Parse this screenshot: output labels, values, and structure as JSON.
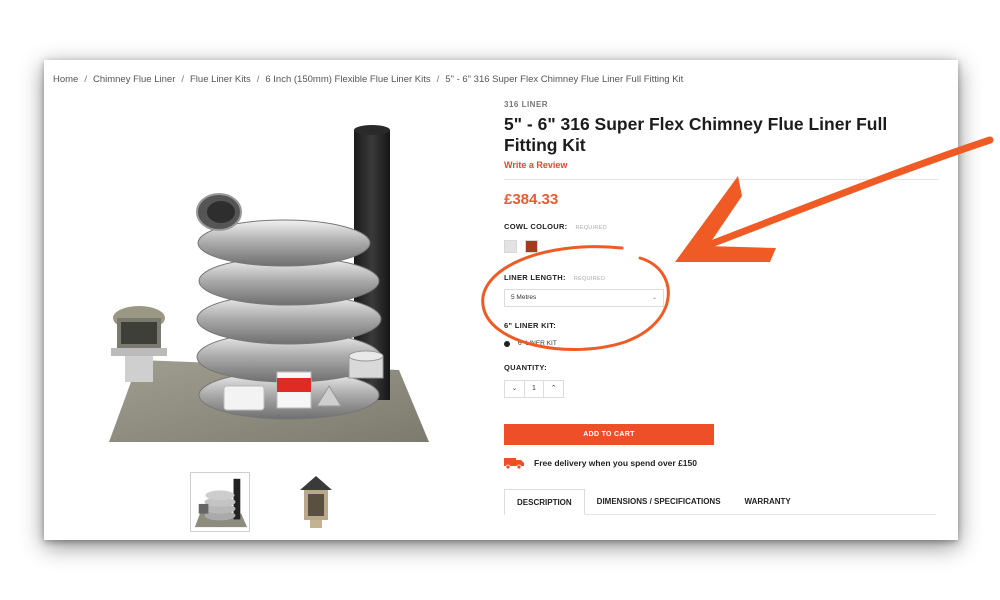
{
  "breadcrumb": [
    {
      "label": "Home"
    },
    {
      "label": "Chimney Flue Liner"
    },
    {
      "label": "Flue Liner Kits"
    },
    {
      "label": "6 Inch (150mm) Flexible Flue Liner Kits"
    },
    {
      "label": "5\" - 6\" 316 Super Flex Chimney Flue Liner Full Fitting Kit"
    }
  ],
  "product": {
    "brand": "316 LINER",
    "title": "5\" - 6\" 316 Super Flex Chimney Flue Liner Full Fitting Kit",
    "review_link": "Write a Review",
    "price": "£384.33",
    "image_alt": "316 Super Flex flue liner kit with coiled liner, black pipe, cowl, plate and accessories"
  },
  "options": {
    "cowl_colour": {
      "label": "COWL COLOUR:",
      "required": "REQUIRED",
      "swatches": [
        "#e3e3e3",
        "#a43a1f"
      ]
    },
    "liner_length": {
      "label": "LINER LENGTH:",
      "required": "REQUIRED",
      "selected": "5 Metres"
    },
    "liner_kit": {
      "label": "6\" LINER KIT:",
      "option": "6\" LINER KIT"
    },
    "quantity": {
      "label": "QUANTITY:",
      "value": "1",
      "decrement": "⌄",
      "increment": "⌃"
    }
  },
  "actions": {
    "add_to_cart": "ADD TO CART",
    "delivery": "Free delivery when you spend over £150"
  },
  "tabs": [
    {
      "label": "DESCRIPTION",
      "active": true
    },
    {
      "label": "DIMENSIONS / SPECIFICATIONS",
      "active": false
    },
    {
      "label": "WARRANTY",
      "active": false
    }
  ],
  "colors": {
    "accent": "#ef4f28",
    "annotation": "#f05a24",
    "price": "#ee5a2f"
  },
  "icons": {
    "select_chevron": "chevron-down-icon",
    "delivery": "delivery-truck-icon"
  }
}
